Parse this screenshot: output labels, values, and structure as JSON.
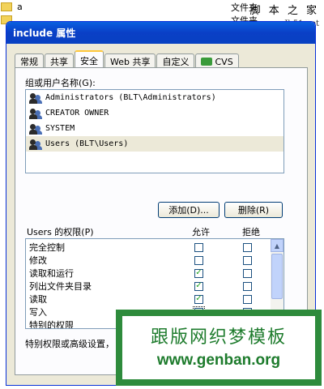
{
  "background": {
    "rows": [
      {
        "name": "a",
        "right": "文件夹"
      },
      {
        "name": "...",
        "right": "文件夹"
      }
    ],
    "watermark_text": "脚 本 之 家",
    "watermark_url": "www.Jb51.net"
  },
  "dialog": {
    "title": "include 属性",
    "tabs": [
      "常规",
      "共享",
      "安全",
      "Web 共享",
      "自定义",
      "CVS"
    ],
    "active_tab": "安全",
    "group_label": "组或用户名称(G):",
    "users": [
      {
        "name": "Administrators (BLT\\Administrators)",
        "selected": false
      },
      {
        "name": "CREATOR OWNER",
        "selected": false
      },
      {
        "name": "SYSTEM",
        "selected": false
      },
      {
        "name": "Users (BLT\\Users)",
        "selected": true
      }
    ],
    "add_button": "添加(D)...",
    "remove_button": "删除(R)",
    "perm_label": "Users 的权限(P)",
    "allow_header": "允许",
    "deny_header": "拒绝",
    "permissions": [
      {
        "name": "完全控制",
        "allow": false,
        "deny": false
      },
      {
        "name": "修改",
        "allow": false,
        "deny": false
      },
      {
        "name": "读取和运行",
        "allow": true,
        "deny": false
      },
      {
        "name": "列出文件夹目录",
        "allow": true,
        "deny": false
      },
      {
        "name": "读取",
        "allow": true,
        "deny": false
      },
      {
        "name": "写入",
        "allow": false,
        "deny": false
      },
      {
        "name": "特别的权限",
        "allow": false,
        "deny": false
      }
    ],
    "special_text": "特别权限或高级设置，"
  },
  "overlay": {
    "cn_text": "跟版网织梦模板",
    "url": "www.genban.org"
  },
  "colors": {
    "title_blue": "#0a5fe0",
    "check_green": "#21a121",
    "banner_green": "#2e8b3c"
  }
}
